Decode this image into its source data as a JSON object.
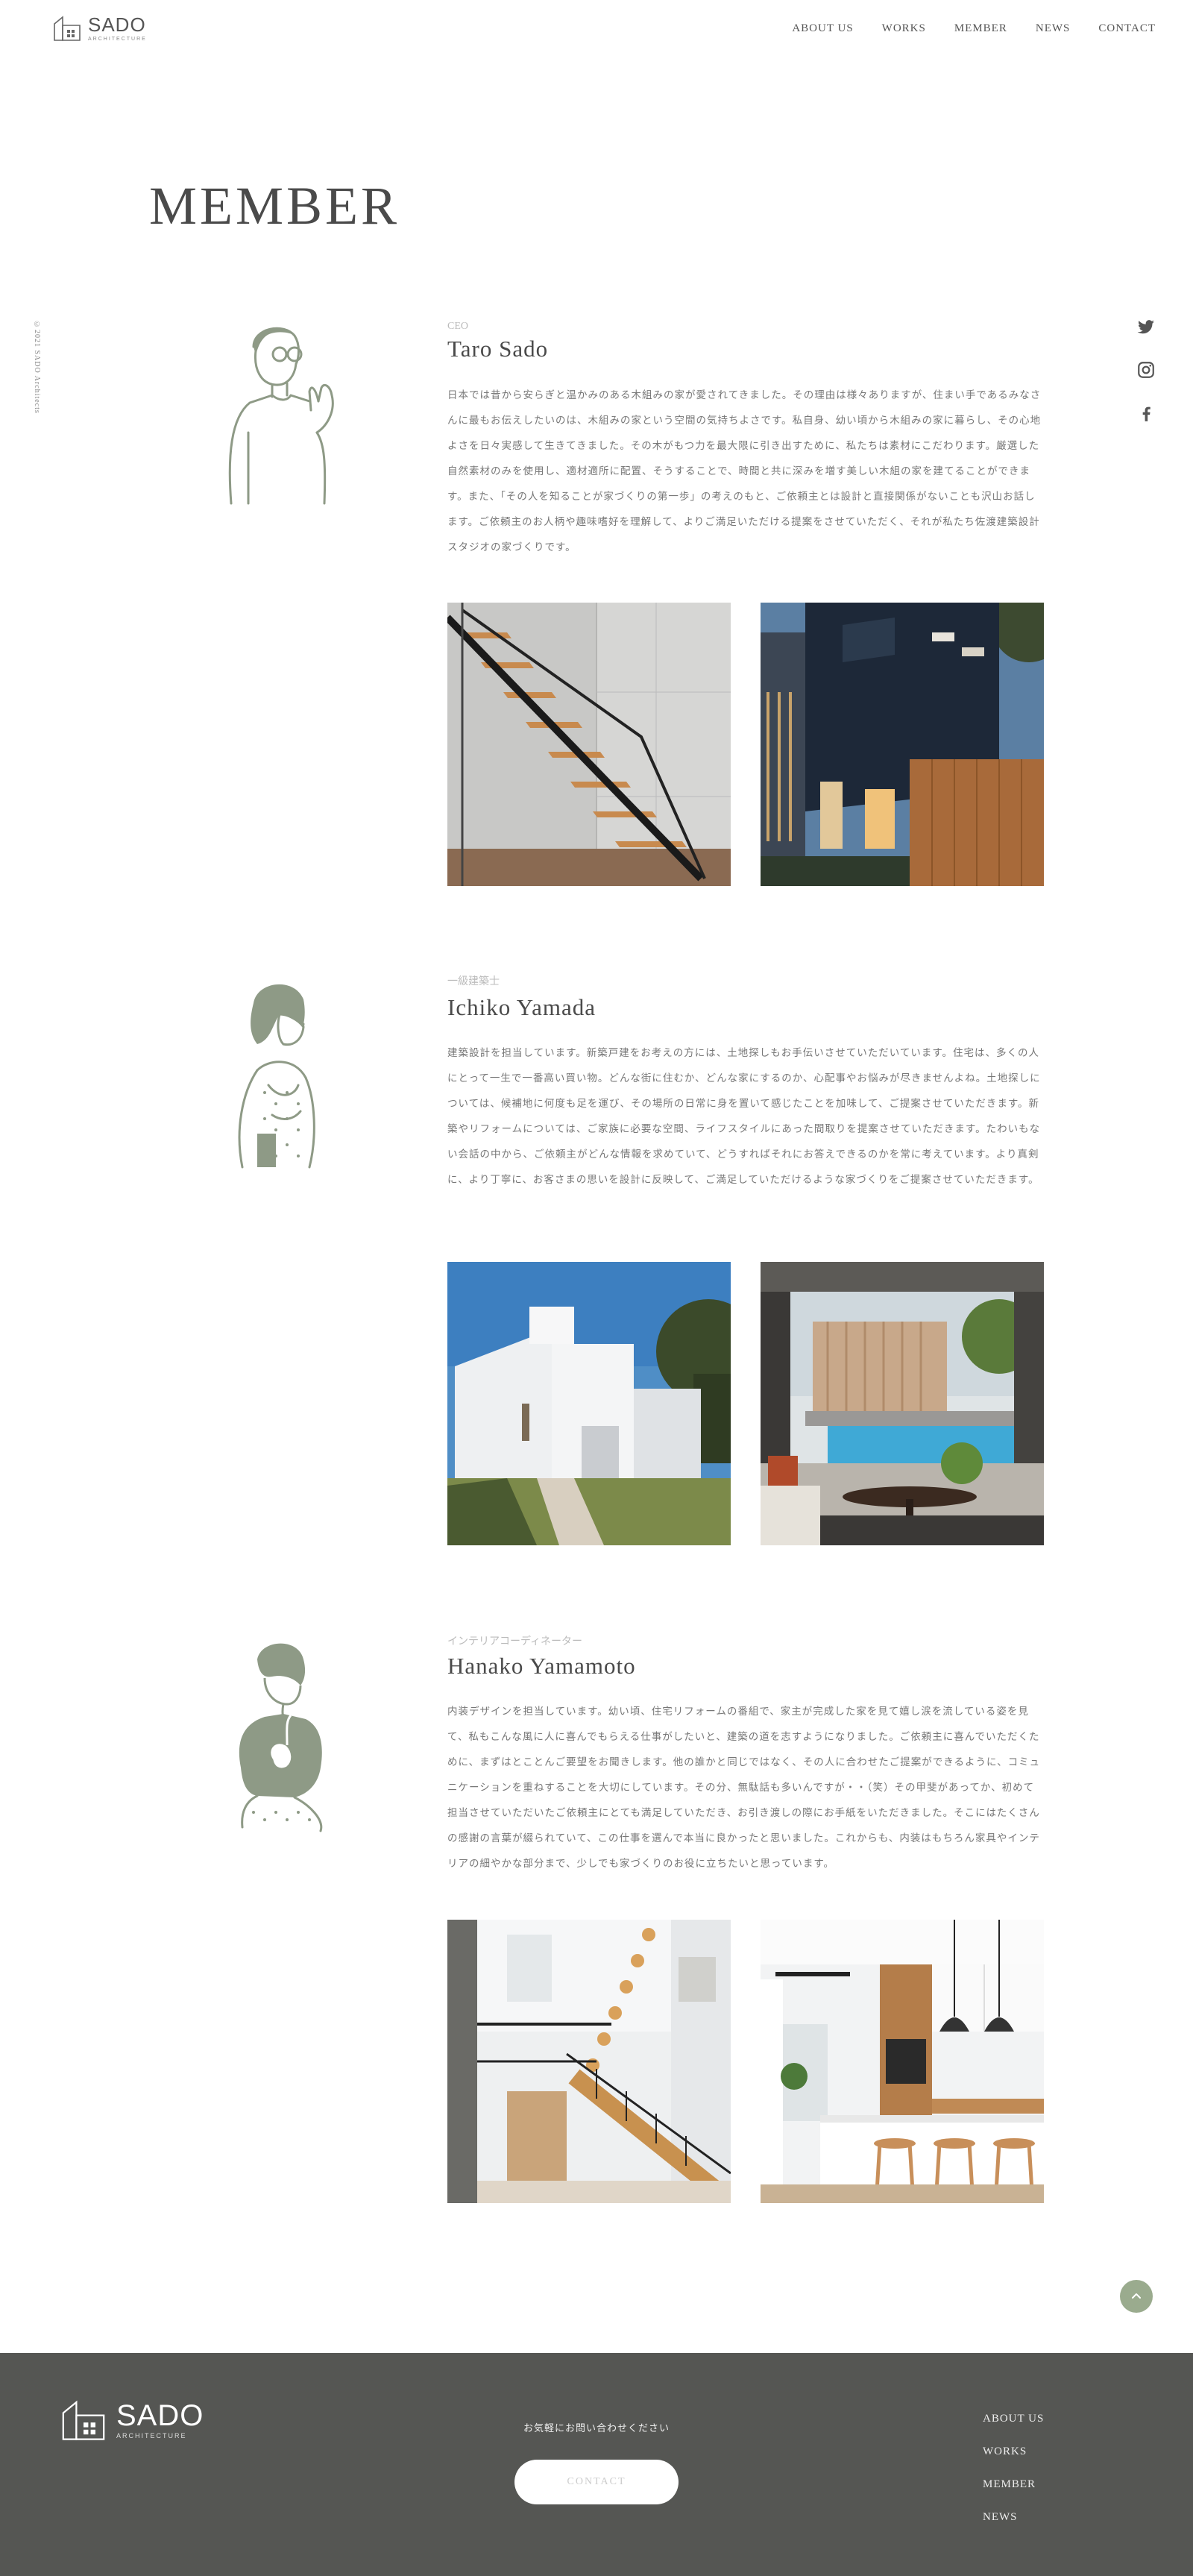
{
  "header": {
    "logo_name": "SADO",
    "logo_sub": "ARCHITECTURE",
    "nav": [
      "ABOUT US",
      "WORKS",
      "MEMBER",
      "NEWS",
      "CONTACT"
    ]
  },
  "side": {
    "copyright": "©2021 SADO Architects",
    "social": [
      "twitter-icon",
      "instagram-icon",
      "facebook-icon"
    ]
  },
  "page_title": "MEMBER",
  "members": [
    {
      "role": "CEO",
      "name": "Taro Sado",
      "bio": "日本では昔から安らぎと温かみのある木組みの家が愛されてきました。その理由は様々ありますが、住まい手であるみなさんに最もお伝えしたいのは、木組みの家という空間の気持ちよさです。私自身、幼い頃から木組みの家に暮らし、その心地よさを日々実感して生きてきました。その木がもつ力を最大限に引き出すために、私たちは素材にこだわります。厳選した自然素材のみを使用し、適材適所に配置、そうすることで、時間と共に深みを増す美しい木組の家を建てることができます。また、「その人を知ることが家づくりの第一歩」の考えのもと、ご依頼主とは設計と直接関係がないことも沢山お話します。ご依頼主のお人柄や趣味嗜好を理解して、よりご満足いただける提案をさせていただく、それが私たち佐渡建築設計スタジオの家づくりです。"
    },
    {
      "role": "一級建築士",
      "name": "Ichiko Yamada",
      "bio": "建築設計を担当しています。新築戸建をお考えの方には、土地探しもお手伝いさせていただいています。住宅は、多くの人にとって一生で一番高い買い物。どんな街に住むか、どんな家にするのか、心配事やお悩みが尽きませんよね。土地探しについては、候補地に何度も足を運び、その場所の日常に身を置いて感じたことを加味して、ご提案させていただきます。新築やリフォームについては、ご家族に必要な空間、ライフスタイルにあった間取りを提案させていただきます。たわいもない会話の中から、ご依頼主がどんな情報を求めていて、どうすればそれにお答えできるのかを常に考えています。より真剣に、より丁寧に、お客さまの思いを設計に反映して、ご満足していただけるような家づくりをご提案させていただきます。"
    },
    {
      "role": "インテリアコーディネーター",
      "name": "Hanako Yamamoto",
      "bio": "内装デザインを担当しています。幼い頃、住宅リフォームの番組で、家主が完成した家を見て嬉し涙を流している姿を見て、私もこんな風に人に喜んでもらえる仕事がしたいと、建築の道を志すようになりました。ご依頼主に喜んでいただくために、まずはとことんご要望をお聞きします。他の誰かと同じではなく、その人に合わせたご提案ができるように、コミュニケーションを重ねすることを大切にしています。その分、無駄話も多いんですが・・（笑）その甲斐があってか、初めて担当させていただいたご依頼主にとても満足していただき、お引き渡しの際にお手紙をいただきました。そこにはたくさんの感謝の言葉が綴られていて、この仕事を選んで本当に良かったと思いました。これからも、内装はもちろん家具やインテリアの細やかな部分まで、少しでも家づくりのお役に立ちたいと思っています。"
    }
  ],
  "footer": {
    "logo_name": "SADO",
    "logo_sub": "ARCHITECTURE",
    "cta_text": "お気軽にお問い合わせください",
    "contact_label": "CONTACT",
    "nav": [
      "ABOUT US",
      "WORKS",
      "MEMBER",
      "NEWS"
    ]
  },
  "colors": {
    "accent": "#9aab8e",
    "footer_bg": "#555653",
    "text": "#555555"
  }
}
